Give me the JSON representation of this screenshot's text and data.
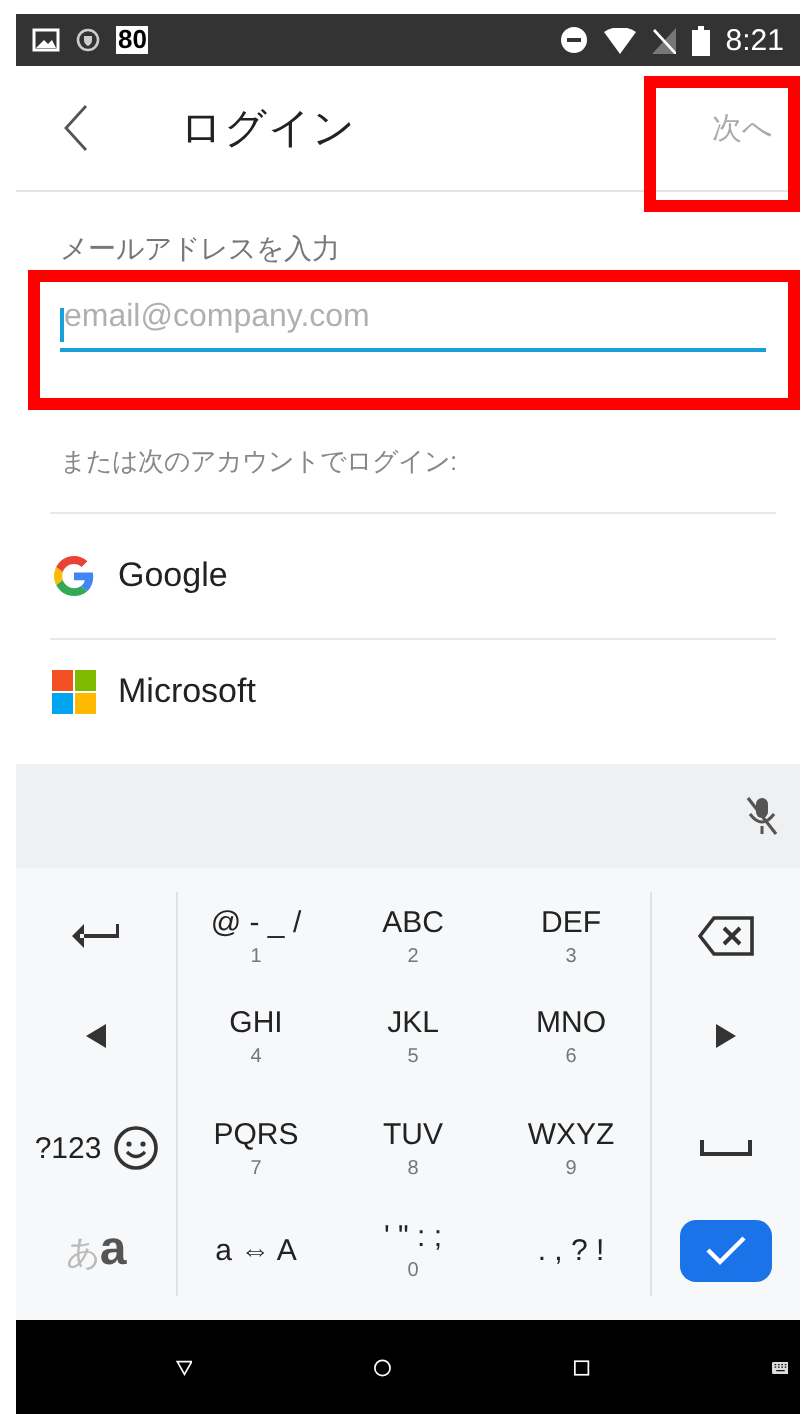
{
  "status_bar": {
    "badge": "80",
    "time": "8:21"
  },
  "header": {
    "title": "ログイン",
    "next_button": {
      "label": "次へ",
      "disabled": true,
      "highlighted": true
    }
  },
  "email": {
    "label": "メールアドレスを入力",
    "placeholder": "email@company.com",
    "focused": true,
    "highlighted": true
  },
  "alt_login": {
    "caption": "または次のアカウントでログイン:",
    "providers": [
      {
        "kind": "google",
        "label": "Google"
      },
      {
        "kind": "microsoft",
        "label": "Microsoft"
      }
    ]
  },
  "keyboard": {
    "keys": [
      {
        "kind": "enter"
      },
      {
        "kind": "text",
        "label": "@ - _ /",
        "digit": "1"
      },
      {
        "kind": "text",
        "label": "ABC",
        "digit": "2"
      },
      {
        "kind": "text",
        "label": "DEF",
        "digit": "3"
      },
      {
        "kind": "backspace"
      },
      {
        "kind": "left"
      },
      {
        "kind": "text",
        "label": "GHI",
        "digit": "4"
      },
      {
        "kind": "text",
        "label": "JKL",
        "digit": "5"
      },
      {
        "kind": "text",
        "label": "MNO",
        "digit": "6"
      },
      {
        "kind": "right"
      },
      {
        "kind": "symbols",
        "label": "?123"
      },
      {
        "kind": "text",
        "label": "PQRS",
        "digit": "7"
      },
      {
        "kind": "text",
        "label": "TUV",
        "digit": "8"
      },
      {
        "kind": "text",
        "label": "WXYZ",
        "digit": "9"
      },
      {
        "kind": "space"
      },
      {
        "kind": "kana",
        "label": "あ**a**"
      },
      {
        "kind": "text",
        "label": "a ⇔ A"
      },
      {
        "kind": "text",
        "label": "' \" : ;",
        "digit": "0"
      },
      {
        "kind": "text",
        "label": ". , ? !"
      },
      {
        "kind": "done"
      }
    ]
  }
}
